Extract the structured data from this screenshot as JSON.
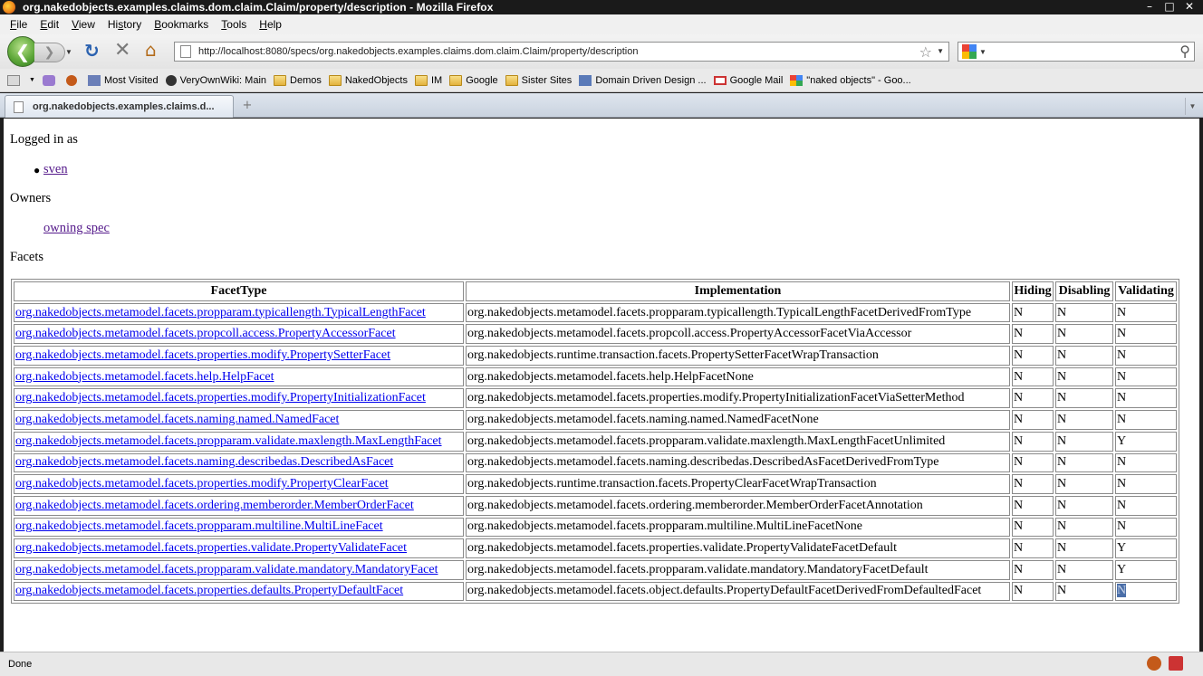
{
  "window": {
    "title": "org.nakedobjects.examples.claims.dom.claim.Claim/property/description - Mozilla Firefox",
    "controls": [
      "–",
      "□",
      "✕"
    ]
  },
  "menu": [
    {
      "key": "F",
      "rest": "ile"
    },
    {
      "key": "E",
      "rest": "dit"
    },
    {
      "key": "V",
      "rest": "iew"
    },
    {
      "key": "",
      "rest": "Hi",
      "key2": "s",
      "rest2": "tory"
    },
    {
      "key": "B",
      "rest": "ookmarks"
    },
    {
      "key": "T",
      "rest": "ools"
    },
    {
      "key": "H",
      "rest": "elp"
    }
  ],
  "nav": {
    "url": "http://localhost:8080/specs/org.nakedobjects.examples.claims.dom.claim.Claim/property/description",
    "search_placeholder": ""
  },
  "bookmarks": [
    {
      "label": "",
      "icon": "generic"
    },
    {
      "label": "",
      "icon": "purple"
    },
    {
      "label": "",
      "icon": "bug"
    },
    {
      "label": "Most Visited",
      "icon": "mostv"
    },
    {
      "label": "VeryOwnWiki: Main",
      "icon": "wiki"
    },
    {
      "label": "Demos",
      "icon": "folder"
    },
    {
      "label": "NakedObjects",
      "icon": "folder"
    },
    {
      "label": "IM",
      "icon": "folder"
    },
    {
      "label": "Google",
      "icon": "folder"
    },
    {
      "label": "Sister Sites",
      "icon": "folder"
    },
    {
      "label": "Domain Driven Design ...",
      "icon": "ddd"
    },
    {
      "label": "Google Mail",
      "icon": "gmail"
    },
    {
      "label": "\"naked objects\" - Goo...",
      "icon": "googleg"
    }
  ],
  "tab": {
    "label": "org.nakedobjects.examples.claims.d...",
    "new_tab": "+"
  },
  "page": {
    "logged_in_label": "Logged in as",
    "user": "sven",
    "owners_label": "Owners",
    "owning_link": "owning spec",
    "facets_label": "Facets",
    "table": {
      "headers": [
        "FacetType",
        "Implementation",
        "Hiding",
        "Disabling",
        "Validating"
      ],
      "rows": [
        [
          "org.nakedobjects.metamodel.facets.propparam.typicallength.TypicalLengthFacet",
          "org.nakedobjects.metamodel.facets.propparam.typicallength.TypicalLengthFacetDerivedFromType",
          "N",
          "N",
          "N"
        ],
        [
          "org.nakedobjects.metamodel.facets.propcoll.access.PropertyAccessorFacet",
          "org.nakedobjects.metamodel.facets.propcoll.access.PropertyAccessorFacetViaAccessor",
          "N",
          "N",
          "N"
        ],
        [
          "org.nakedobjects.metamodel.facets.properties.modify.PropertySetterFacet",
          "org.nakedobjects.runtime.transaction.facets.PropertySetterFacetWrapTransaction",
          "N",
          "N",
          "N"
        ],
        [
          "org.nakedobjects.metamodel.facets.help.HelpFacet",
          "org.nakedobjects.metamodel.facets.help.HelpFacetNone",
          "N",
          "N",
          "N"
        ],
        [
          "org.nakedobjects.metamodel.facets.properties.modify.PropertyInitializationFacet",
          "org.nakedobjects.metamodel.facets.properties.modify.PropertyInitializationFacetViaSetterMethod",
          "N",
          "N",
          "N"
        ],
        [
          "org.nakedobjects.metamodel.facets.naming.named.NamedFacet",
          "org.nakedobjects.metamodel.facets.naming.named.NamedFacetNone",
          "N",
          "N",
          "N"
        ],
        [
          "org.nakedobjects.metamodel.facets.propparam.validate.maxlength.MaxLengthFacet",
          "org.nakedobjects.metamodel.facets.propparam.validate.maxlength.MaxLengthFacetUnlimited",
          "N",
          "N",
          "Y"
        ],
        [
          "org.nakedobjects.metamodel.facets.naming.describedas.DescribedAsFacet",
          "org.nakedobjects.metamodel.facets.naming.describedas.DescribedAsFacetDerivedFromType",
          "N",
          "N",
          "N"
        ],
        [
          "org.nakedobjects.metamodel.facets.properties.modify.PropertyClearFacet",
          "org.nakedobjects.runtime.transaction.facets.PropertyClearFacetWrapTransaction",
          "N",
          "N",
          "N"
        ],
        [
          "org.nakedobjects.metamodel.facets.ordering.memberorder.MemberOrderFacet",
          "org.nakedobjects.metamodel.facets.ordering.memberorder.MemberOrderFacetAnnotation",
          "N",
          "N",
          "N"
        ],
        [
          "org.nakedobjects.metamodel.facets.propparam.multiline.MultiLineFacet",
          "org.nakedobjects.metamodel.facets.propparam.multiline.MultiLineFacetNone",
          "N",
          "N",
          "N"
        ],
        [
          "org.nakedobjects.metamodel.facets.properties.validate.PropertyValidateFacet",
          "org.nakedobjects.metamodel.facets.properties.validate.PropertyValidateFacetDefault",
          "N",
          "N",
          "Y"
        ],
        [
          "org.nakedobjects.metamodel.facets.propparam.validate.mandatory.MandatoryFacet",
          "org.nakedobjects.metamodel.facets.propparam.validate.mandatory.MandatoryFacetDefault",
          "N",
          "N",
          "Y"
        ],
        [
          "org.nakedobjects.metamodel.facets.properties.defaults.PropertyDefaultFacet",
          "org.nakedobjects.metamodel.facets.object.defaults.PropertyDefaultFacetDerivedFromDefaultedFacet",
          "N",
          "N",
          "N"
        ]
      ],
      "selected_cell": {
        "row": 13,
        "col": 4
      }
    }
  },
  "status": {
    "text": "Done"
  },
  "colors": {
    "link": "#0000ee",
    "visited_link": "#551a8b",
    "selection": "#4a6ea8"
  }
}
